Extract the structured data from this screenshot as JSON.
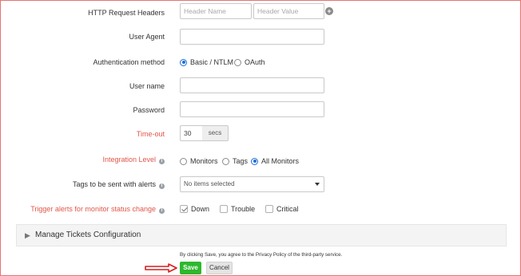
{
  "colors": {
    "required_label": "#e0564a",
    "accent": "#1e6fd9",
    "save_button": "#2eb82e",
    "arrow": "#d81e1e"
  },
  "form": {
    "http_headers": {
      "label": "HTTP Request Headers",
      "name_placeholder": "Header Name",
      "value_placeholder": "Header Value",
      "add_icon": "plus-circle-icon"
    },
    "user_agent": {
      "label": "User Agent",
      "value": ""
    },
    "auth_method": {
      "label": "Authentication method",
      "options": [
        "Basic / NTLM",
        "OAuth"
      ],
      "selected": "Basic / NTLM"
    },
    "user_name": {
      "label": "User name",
      "value": ""
    },
    "password": {
      "label": "Password",
      "value": ""
    },
    "timeout": {
      "label": "Time-out",
      "value": "30",
      "unit": "secs"
    },
    "integration_level": {
      "label": "Integration Level",
      "options": [
        "Monitors",
        "Tags",
        "All Monitors"
      ],
      "selected": "All Monitors",
      "info_icon": "info-icon"
    },
    "tags": {
      "label": "Tags to be sent with alerts",
      "value": "No items selected"
    },
    "trigger_alerts": {
      "label": "Trigger alerts for monitor status change",
      "options": [
        "Down",
        "Trouble",
        "Critical"
      ],
      "checked": [
        "Down"
      ]
    }
  },
  "manage_tickets": {
    "title": "Manage Tickets Configuration"
  },
  "footer": {
    "note": "By clicking Save, you agree to the Privacy Policy of the third-party service.",
    "save_label": "Save",
    "cancel_label": "Cancel"
  }
}
